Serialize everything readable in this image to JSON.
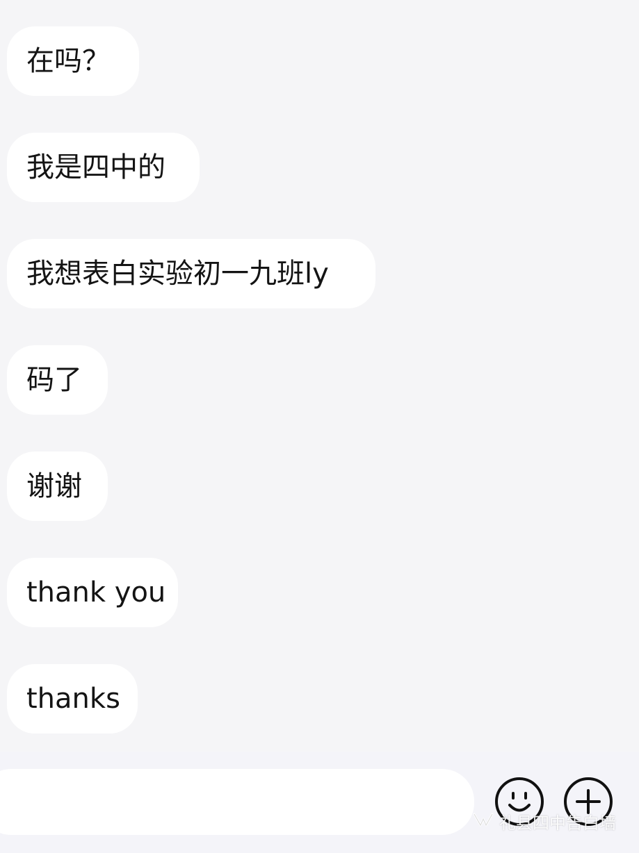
{
  "messages": [
    {
      "text": "在吗？"
    },
    {
      "text": "我是四中的"
    },
    {
      "text": "我想表白实验初一九班ly"
    },
    {
      "text": "码了"
    },
    {
      "text": "谢谢"
    },
    {
      "text": "thank you"
    },
    {
      "text": "thanks"
    }
  ],
  "input": {
    "value": "",
    "placeholder": ""
  },
  "buttons": {
    "emoji_icon": "smiley-face-icon",
    "plus_icon": "plus-circle-icon"
  },
  "watermark": {
    "icon": "wechat-channel-logo-icon",
    "text": "礼县四中告白墙"
  },
  "colors": {
    "background": "#f5f5f7",
    "bubble": "#ffffff",
    "text": "#141414"
  }
}
